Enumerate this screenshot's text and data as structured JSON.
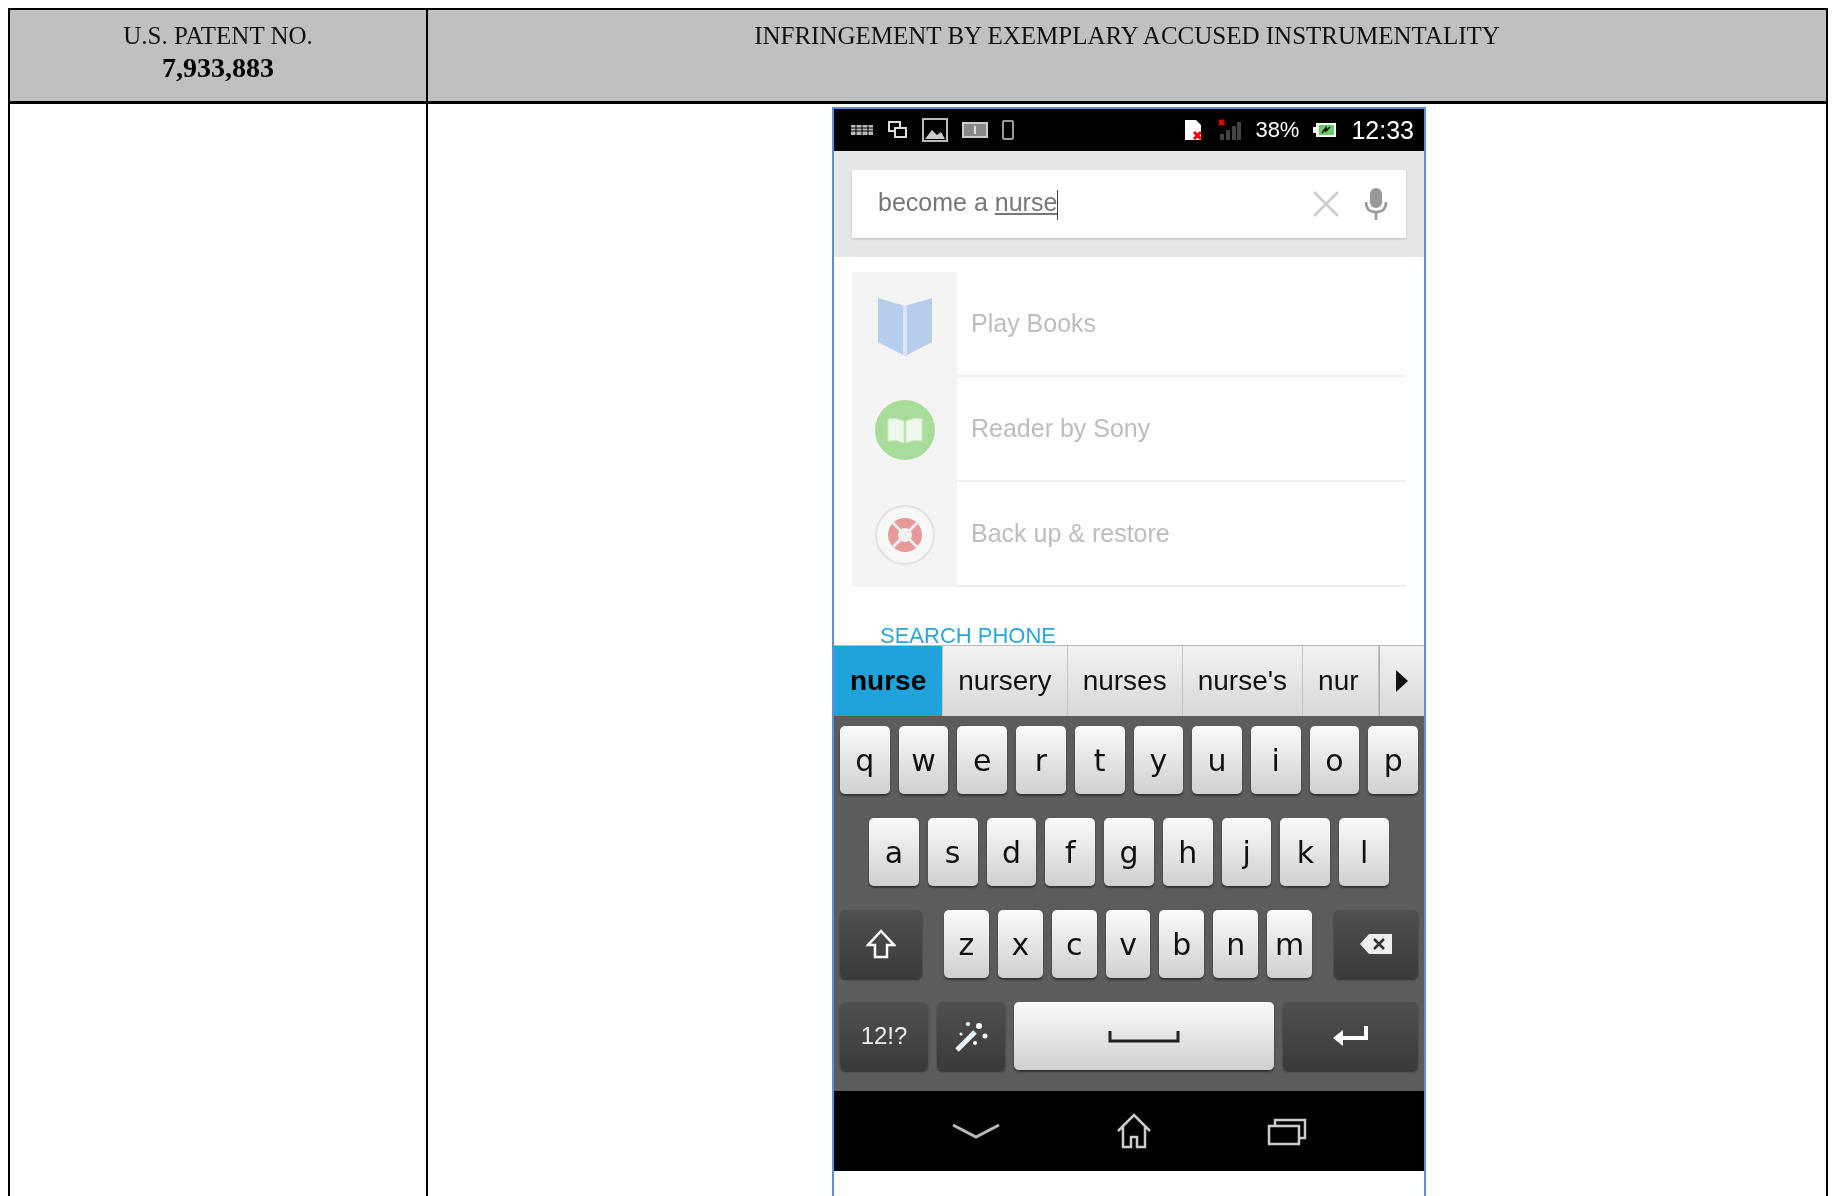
{
  "header": {
    "column_1": {
      "line_1": "U.S. PATENT NO.",
      "line_2": "7,933,883"
    },
    "column_2": "INFRINGEMENT BY EXEMPLARY ACCUSED INSTRUMENTALITY"
  },
  "phone": {
    "status_bar": {
      "battery": "38%",
      "time": "12:33"
    },
    "search": {
      "value_prefix": "become a ",
      "composing_word": "nurse"
    },
    "results": [
      {
        "kind": "book",
        "label": "Play Books"
      },
      {
        "kind": "reader",
        "label": "Reader by Sony"
      },
      {
        "kind": "backup",
        "label": "Back up & restore"
      }
    ],
    "section_label": "SEARCH PHONE",
    "suggestions": [
      {
        "text": "nurse",
        "selected": true
      },
      {
        "text": "nursery",
        "selected": false
      },
      {
        "text": "nurses",
        "selected": false
      },
      {
        "text": "nurse's",
        "selected": false
      },
      {
        "text": "nur",
        "selected": false
      }
    ],
    "keyboard": {
      "rows": [
        [
          "q",
          "w",
          "e",
          "r",
          "t",
          "y",
          "u",
          "i",
          "o",
          "p"
        ],
        [
          "a",
          "s",
          "d",
          "f",
          "g",
          "h",
          "j",
          "k",
          "l"
        ],
        [
          "z",
          "x",
          "c",
          "v",
          "b",
          "n",
          "m"
        ]
      ],
      "symbols_key": "12!?"
    }
  }
}
